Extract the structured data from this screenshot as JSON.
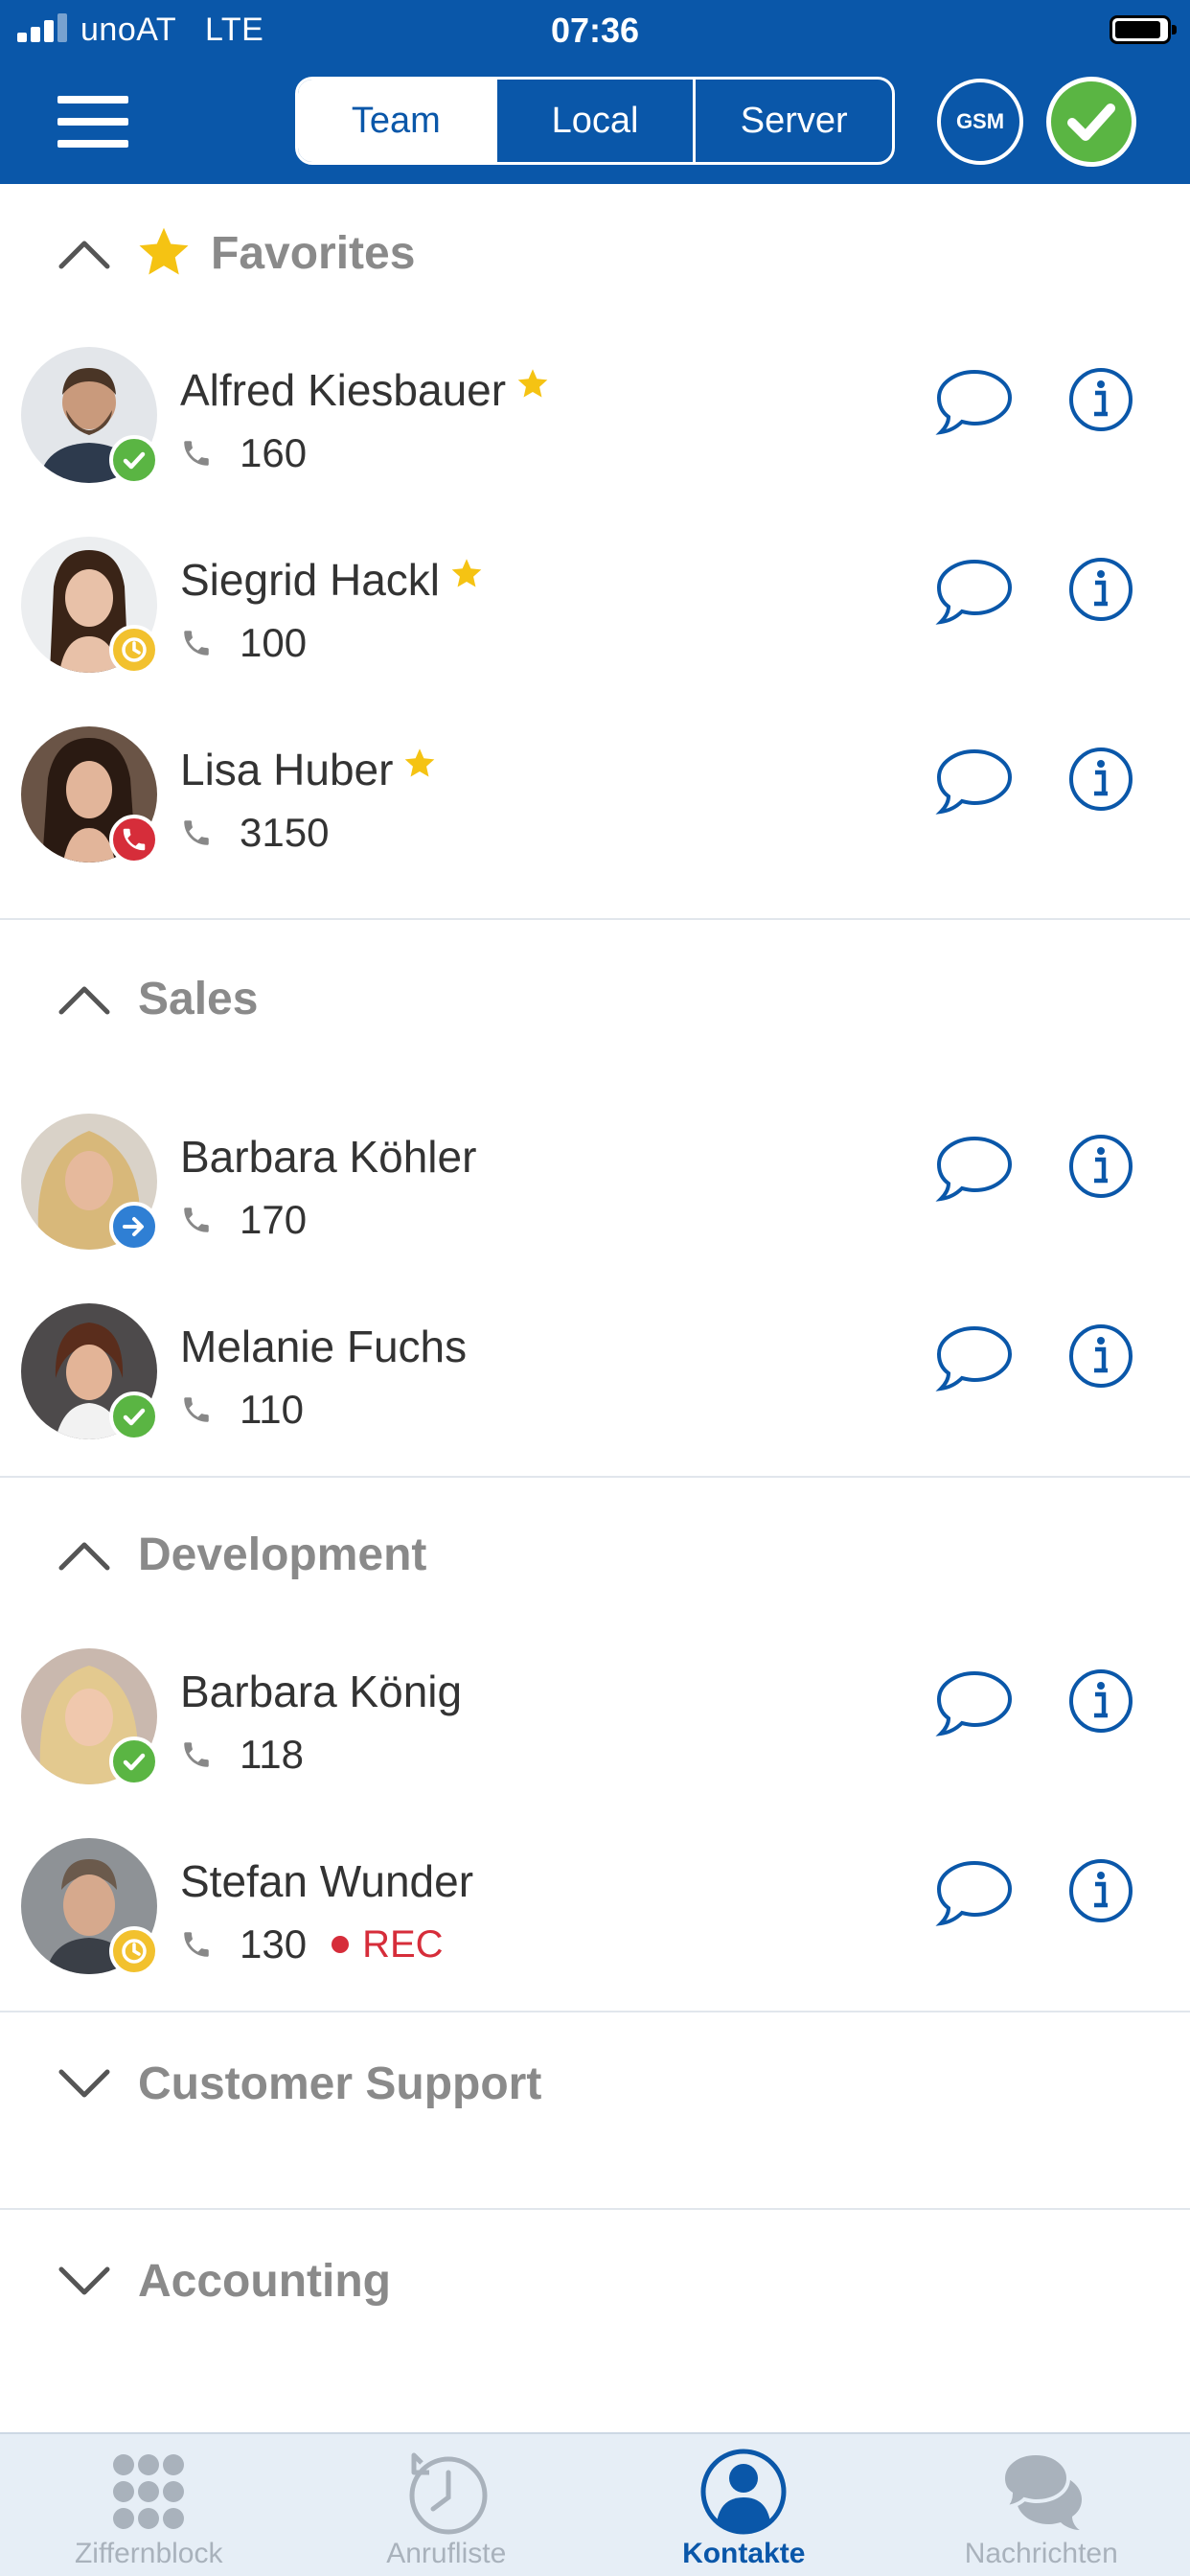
{
  "status_bar": {
    "carrier": "unoAT",
    "network": "LTE",
    "time": "07:36"
  },
  "header": {
    "segments": [
      {
        "label": "Team",
        "active": true
      },
      {
        "label": "Local",
        "active": false
      },
      {
        "label": "Server",
        "active": false
      }
    ],
    "gsm_label": "GSM",
    "presence_status": "available"
  },
  "groups": [
    {
      "title": "Favorites",
      "expanded": true,
      "favorite": true,
      "contacts": [
        {
          "name": "Alfred Kiesbauer",
          "ext": "160",
          "status": "available",
          "favorite": true
        },
        {
          "name": "Siegrid Hackl",
          "ext": "100",
          "status": "away",
          "favorite": true
        },
        {
          "name": "Lisa Huber",
          "ext": "3150",
          "status": "busy",
          "favorite": true
        }
      ]
    },
    {
      "title": "Sales",
      "expanded": true,
      "contacts": [
        {
          "name": "Barbara Köhler",
          "ext": "170",
          "status": "forward"
        },
        {
          "name": "Melanie Fuchs",
          "ext": "110",
          "status": "available"
        }
      ]
    },
    {
      "title": "Development",
      "expanded": true,
      "contacts": [
        {
          "name": "Barbara König",
          "ext": "118",
          "status": "available"
        },
        {
          "name": "Stefan Wunder",
          "ext": "130",
          "status": "away",
          "rec": "REC"
        }
      ]
    },
    {
      "title": "Customer Support",
      "expanded": false,
      "contacts": []
    },
    {
      "title": "Accounting",
      "expanded": false,
      "contacts": []
    }
  ],
  "tabs": [
    {
      "label": "Ziffernblock",
      "icon": "keypad-icon",
      "active": false
    },
    {
      "label": "Anrufliste",
      "icon": "call-history-icon",
      "active": false
    },
    {
      "label": "Kontakte",
      "icon": "contacts-icon",
      "active": true
    },
    {
      "label": "Nachrichten",
      "icon": "messages-icon",
      "active": false
    }
  ],
  "colors": {
    "primary": "#0a57a9",
    "available": "#5ab543",
    "away": "#f2c12e",
    "busy": "#d62d3a",
    "forward": "#2f7fd4",
    "star": "#f5c313",
    "group_title": "#8a8a8a"
  }
}
